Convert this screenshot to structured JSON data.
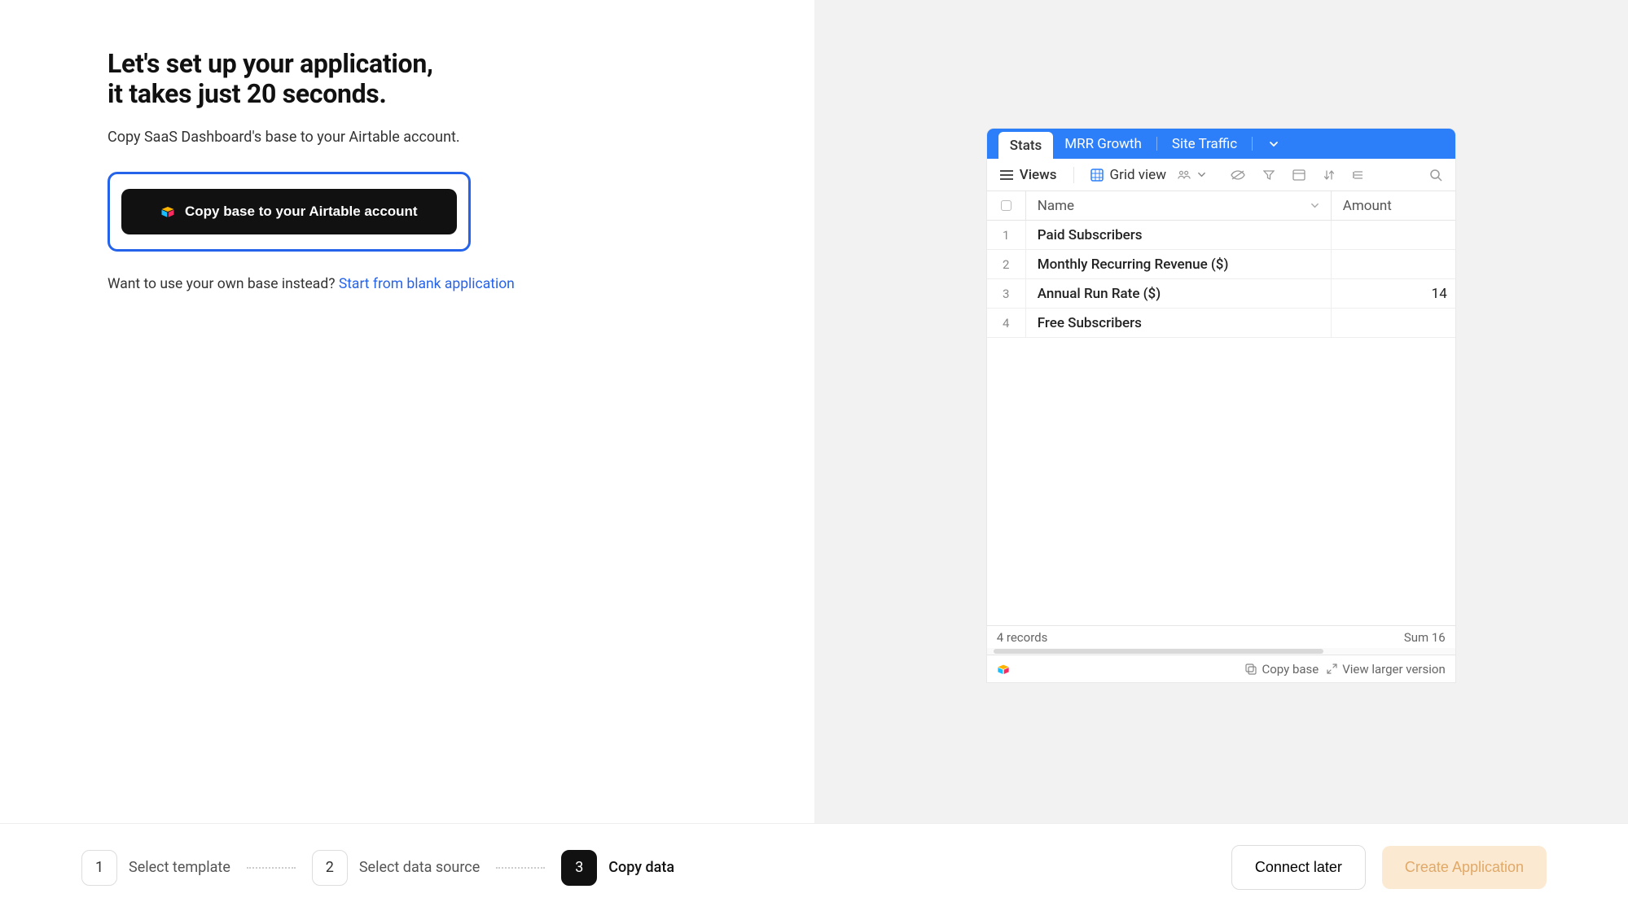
{
  "heading_line1": "Let's set up your application,",
  "heading_line2": "it takes just 20 seconds.",
  "subtext": "Copy SaaS Dashboard's base to your Airtable account.",
  "cta_label": "Copy base to your Airtable account",
  "alt_prefix": "Want to use your own base instead? ",
  "alt_link": "Start from blank application",
  "airtable": {
    "tabs": [
      "Stats",
      "MRR Growth",
      "Site Traffic"
    ],
    "views_label": "Views",
    "gridview_label": "Grid view",
    "columns": {
      "name": "Name",
      "amount": "Amount"
    },
    "rows": [
      {
        "num": "1",
        "name": "Paid Subscribers",
        "amount": ""
      },
      {
        "num": "2",
        "name": "Monthly Recurring Revenue ($)",
        "amount": ""
      },
      {
        "num": "3",
        "name": "Annual Run Rate ($)",
        "amount": "14"
      },
      {
        "num": "4",
        "name": "Free Subscribers",
        "amount": ""
      }
    ],
    "record_count": "4 records",
    "summary_sum": "Sum 16",
    "footer_copy": "Copy base",
    "footer_larger": "View larger version"
  },
  "steps": [
    {
      "num": "1",
      "label": "Select template"
    },
    {
      "num": "2",
      "label": "Select data source"
    },
    {
      "num": "3",
      "label": "Copy data"
    }
  ],
  "footer_buttons": {
    "connect_later": "Connect later",
    "create_app": "Create Application"
  }
}
